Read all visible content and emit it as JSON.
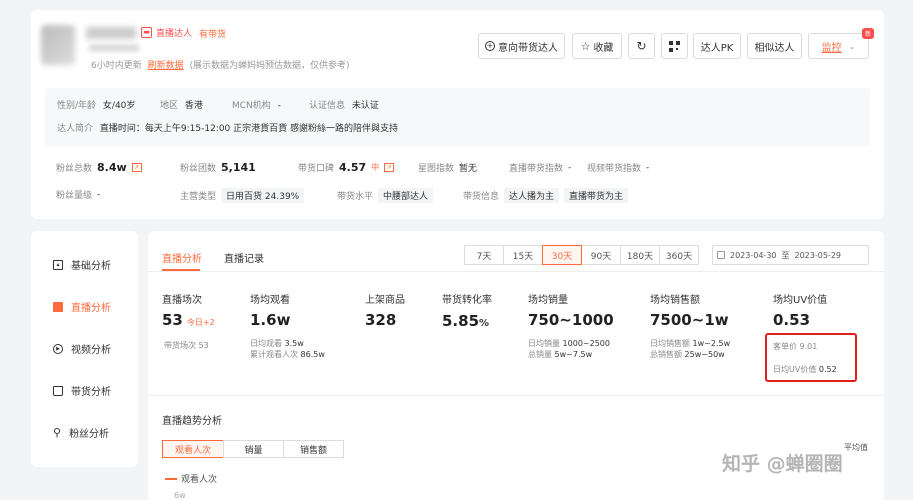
{
  "header": {
    "live_tag": "直播达人",
    "goods_tag": "有带货",
    "update_text": "6小时内更新",
    "refresh_link": "刷新数据",
    "refresh_note": "(展示数据为蝉妈妈预估数据，仅供参考)",
    "new_badge": "新"
  },
  "actions": {
    "intent": "意向带货达人",
    "favorite": "收藏",
    "pk": "达人PK",
    "similar": "相似达人",
    "monitor": "监控"
  },
  "profile": {
    "gender_label": "性别/年龄",
    "gender_value": "女/40岁",
    "region_label": "地区",
    "region_value": "香港",
    "mcn_label": "MCN机构",
    "mcn_value": "-",
    "cert_label": "认证信息",
    "cert_value": "未认证",
    "intro_label": "达人简介",
    "intro_value": "直播时间：每天上午9:15-12:00 正宗港貨百貨 感謝粉絲一路的陪伴與支持"
  },
  "metrics": {
    "fans_label": "粉丝总数",
    "fans_value": "8.4w",
    "group_label": "粉丝团数",
    "group_value": "5,141",
    "reputation_label": "带货口碑",
    "reputation_value": "4.57",
    "reputation_level": "中",
    "star_label": "星图指数",
    "star_value": "暂无",
    "live_index_label": "直播带货指数",
    "live_index_value": "-",
    "video_index_label": "视频带货指数",
    "video_index_value": "-",
    "fans_level_label": "粉丝量级",
    "fans_level_value": "-",
    "category_label": "主营类型",
    "category_value": "日用百货",
    "category_pct": "24.39%",
    "level_label": "带货水平",
    "level_value": "中腰部达人",
    "info_label": "带货信息",
    "info_tag1": "达人播为主",
    "info_tag2": "直播带货为主"
  },
  "sidebar": {
    "items": [
      {
        "label": "基础分析"
      },
      {
        "label": "直播分析"
      },
      {
        "label": "视频分析"
      },
      {
        "label": "带货分析"
      },
      {
        "label": "粉丝分析"
      }
    ]
  },
  "main": {
    "tab_live": "直播分析",
    "tab_records": "直播记录",
    "ranges": [
      "7天",
      "15天",
      "30天",
      "90天",
      "180天",
      "360天"
    ],
    "active_range": "30天",
    "date_start": "2023-04-30",
    "date_sep": "至",
    "date_end": "2023-05-29"
  },
  "stats": {
    "sessions_label": "直播场次",
    "sessions_value": "53",
    "sessions_today": "今日+2",
    "sessions_sub_label": "带货场次",
    "sessions_sub_value": "53",
    "views_label": "场均观看",
    "views_value": "1.6w",
    "views_sub1_label": "日均观看",
    "views_sub1_value": "3.5w",
    "views_sub2_label": "累计观看人次",
    "views_sub2_value": "86.5w",
    "products_label": "上架商品",
    "products_value": "328",
    "conv_label": "带货转化率",
    "conv_value": "5.85",
    "conv_unit": "%",
    "sales_label": "场均销量",
    "sales_value": "750~1000",
    "sales_sub1_label": "日均销量",
    "sales_sub1_value": "1000~2500",
    "sales_sub2_label": "总销量",
    "sales_sub2_value": "5w~7.5w",
    "amount_label": "场均销售额",
    "amount_value": "7500~1w",
    "amount_sub1_label": "日均销售额",
    "amount_sub1_value": "1w~2.5w",
    "amount_sub2_label": "总销售额",
    "amount_sub2_value": "25w~50w",
    "uv_label": "场均UV价值",
    "uv_value": "0.53",
    "uv_sub1_label": "客单价",
    "uv_sub1_value": "9.01",
    "uv_sub2_label": "日均UV价值",
    "uv_sub2_value": "0.52"
  },
  "trend": {
    "title": "直播趋势分析",
    "tabs": [
      "观看人次",
      "销量",
      "销售额"
    ],
    "legend": "观看人次",
    "y_tick": "6w",
    "avg_label": "平均值"
  },
  "watermark": "知乎 @蝉圈圈",
  "colors": {
    "accent": "#ff6a3d",
    "highlight_box": "#e02020"
  }
}
